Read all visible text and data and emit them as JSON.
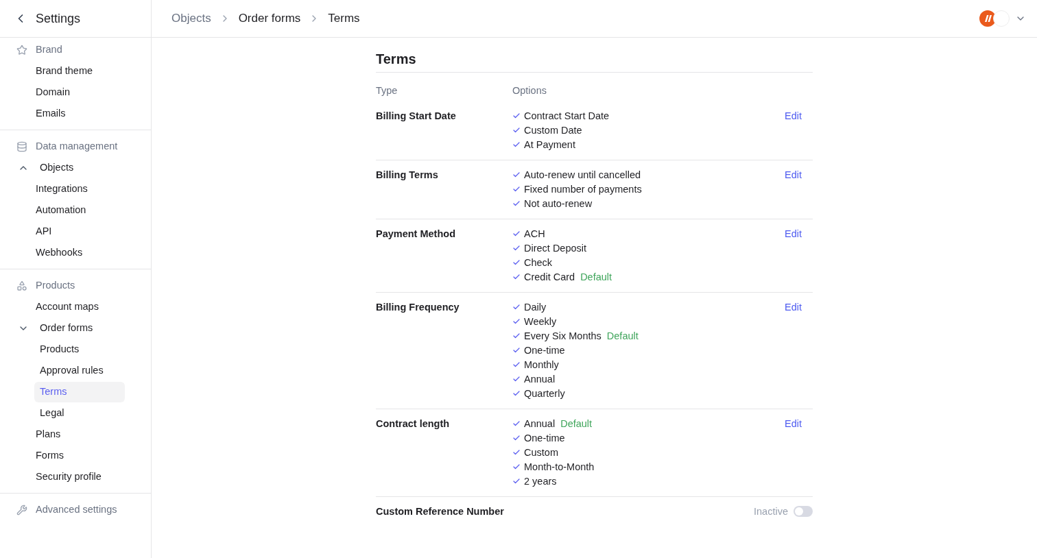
{
  "sidebar": {
    "title": "Settings",
    "sections": [
      {
        "heading": "Brand",
        "items": [
          {
            "label": "Brand theme",
            "selected": false
          },
          {
            "label": "Domain",
            "selected": false
          },
          {
            "label": "Emails",
            "selected": false
          }
        ]
      },
      {
        "heading": "Data management",
        "items": [
          {
            "label": "Objects",
            "selected": false,
            "expanded": false
          },
          {
            "label": "Integrations",
            "selected": false
          },
          {
            "label": "Automation",
            "selected": false
          },
          {
            "label": "API",
            "selected": false
          },
          {
            "label": "Webhooks",
            "selected": false
          }
        ]
      },
      {
        "heading": "Products",
        "items": [
          {
            "label": "Account maps",
            "selected": false
          },
          {
            "label": "Order forms",
            "selected": false,
            "expanded": true,
            "children": [
              {
                "label": "Products",
                "selected": false
              },
              {
                "label": "Approval rules",
                "selected": false
              },
              {
                "label": "Terms",
                "selected": true
              },
              {
                "label": "Legal",
                "selected": false
              }
            ]
          },
          {
            "label": "Plans",
            "selected": false
          },
          {
            "label": "Forms",
            "selected": false
          },
          {
            "label": "Security profile",
            "selected": false
          }
        ]
      },
      {
        "heading": "Advanced settings"
      }
    ]
  },
  "breadcrumbs": [
    "Objects",
    "Order forms",
    "Terms"
  ],
  "page": {
    "title": "Terms",
    "columns": [
      "Type",
      "Options"
    ],
    "rows": [
      {
        "kind": "options",
        "type": "Billing Start Date",
        "action": "Edit",
        "options": [
          {
            "label": "Contract Start Date"
          },
          {
            "label": "Custom Date"
          },
          {
            "label": "At Payment"
          }
        ]
      },
      {
        "kind": "options",
        "type": "Billing Terms",
        "action": "Edit",
        "options": [
          {
            "label": "Auto-renew until cancelled"
          },
          {
            "label": "Fixed number of payments"
          },
          {
            "label": "Not auto-renew"
          }
        ]
      },
      {
        "kind": "options",
        "type": "Payment Method",
        "action": "Edit",
        "options": [
          {
            "label": "ACH"
          },
          {
            "label": "Direct Deposit"
          },
          {
            "label": "Check"
          },
          {
            "label": "Credit Card",
            "badge": "Default"
          }
        ]
      },
      {
        "kind": "options",
        "type": "Billing Frequency",
        "action": "Edit",
        "options": [
          {
            "label": "Daily"
          },
          {
            "label": "Weekly"
          },
          {
            "label": "Every Six Months",
            "badge": "Default"
          },
          {
            "label": "One-time"
          },
          {
            "label": "Monthly"
          },
          {
            "label": "Annual"
          },
          {
            "label": "Quarterly"
          }
        ]
      },
      {
        "kind": "options",
        "type": "Contract length",
        "action": "Edit",
        "options": [
          {
            "label": "Annual",
            "badge": "Default"
          },
          {
            "label": "One-time"
          },
          {
            "label": "Custom"
          },
          {
            "label": "Month-to-Month"
          },
          {
            "label": "2 years"
          }
        ]
      },
      {
        "kind": "toggle",
        "type": "Custom Reference Number",
        "status": "Inactive",
        "on": false
      }
    ]
  }
}
